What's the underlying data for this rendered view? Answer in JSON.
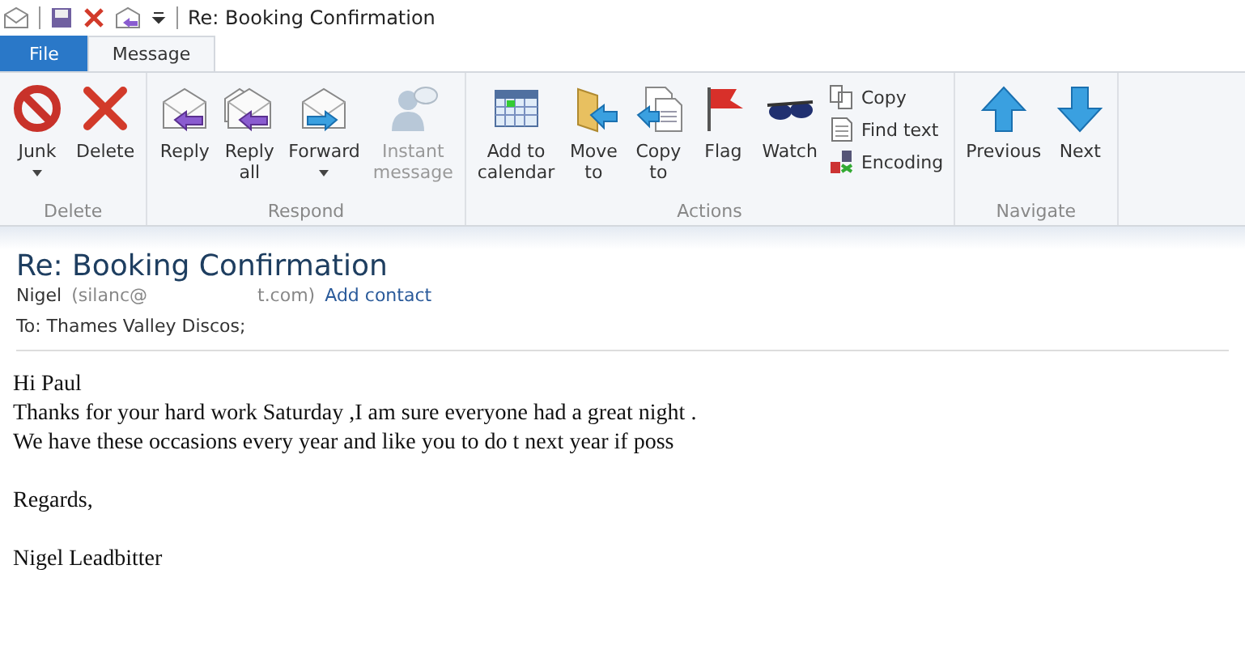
{
  "window": {
    "title": "Re: Booking Confirmation"
  },
  "tabs": [
    {
      "label": "File",
      "kind": "file",
      "selected": false
    },
    {
      "label": "Message",
      "kind": "tab",
      "selected": true
    }
  ],
  "ribbon": {
    "groups": [
      {
        "label": "Delete",
        "buttons": [
          {
            "label": "Junk",
            "dropdown": true,
            "disabled": false
          },
          {
            "label": "Delete",
            "dropdown": false,
            "disabled": false
          }
        ]
      },
      {
        "label": "Respond",
        "buttons": [
          {
            "label": "Reply",
            "dropdown": false,
            "disabled": false
          },
          {
            "label": "Reply\nall",
            "dropdown": false,
            "disabled": false
          },
          {
            "label": "Forward",
            "dropdown": true,
            "disabled": false
          },
          {
            "label": "Instant\nmessage",
            "dropdown": false,
            "disabled": true
          }
        ]
      },
      {
        "label": "Actions",
        "buttons": [
          {
            "label": "Add to\ncalendar",
            "dropdown": false,
            "disabled": false
          },
          {
            "label": "Move\nto",
            "dropdown": false,
            "disabled": false
          },
          {
            "label": "Copy\nto",
            "dropdown": false,
            "disabled": false
          },
          {
            "label": "Flag",
            "dropdown": false,
            "disabled": false
          },
          {
            "label": "Watch",
            "dropdown": false,
            "disabled": false
          }
        ],
        "small_buttons": [
          {
            "label": "Copy"
          },
          {
            "label": "Find text"
          },
          {
            "label": "Encoding"
          }
        ]
      },
      {
        "label": "Navigate",
        "buttons": [
          {
            "label": "Previous",
            "dropdown": false,
            "disabled": false
          },
          {
            "label": "Next",
            "dropdown": false,
            "disabled": false
          }
        ]
      }
    ]
  },
  "message": {
    "subject": "Re: Booking Confirmation",
    "sender": "Nigel",
    "sender_address_start": "(silanc@",
    "sender_address_end": "t.com)",
    "add_contact": "Add contact",
    "to": "To: Thames Valley Discos;",
    "body": [
      [
        "Hi Paul",
        "Thanks for your hard work Saturday ,I am sure everyone had a great night .",
        "We have these occasions every year and like you to do t next year if poss"
      ],
      [
        "Regards,"
      ],
      [
        "Nigel Leadbitter"
      ]
    ]
  }
}
